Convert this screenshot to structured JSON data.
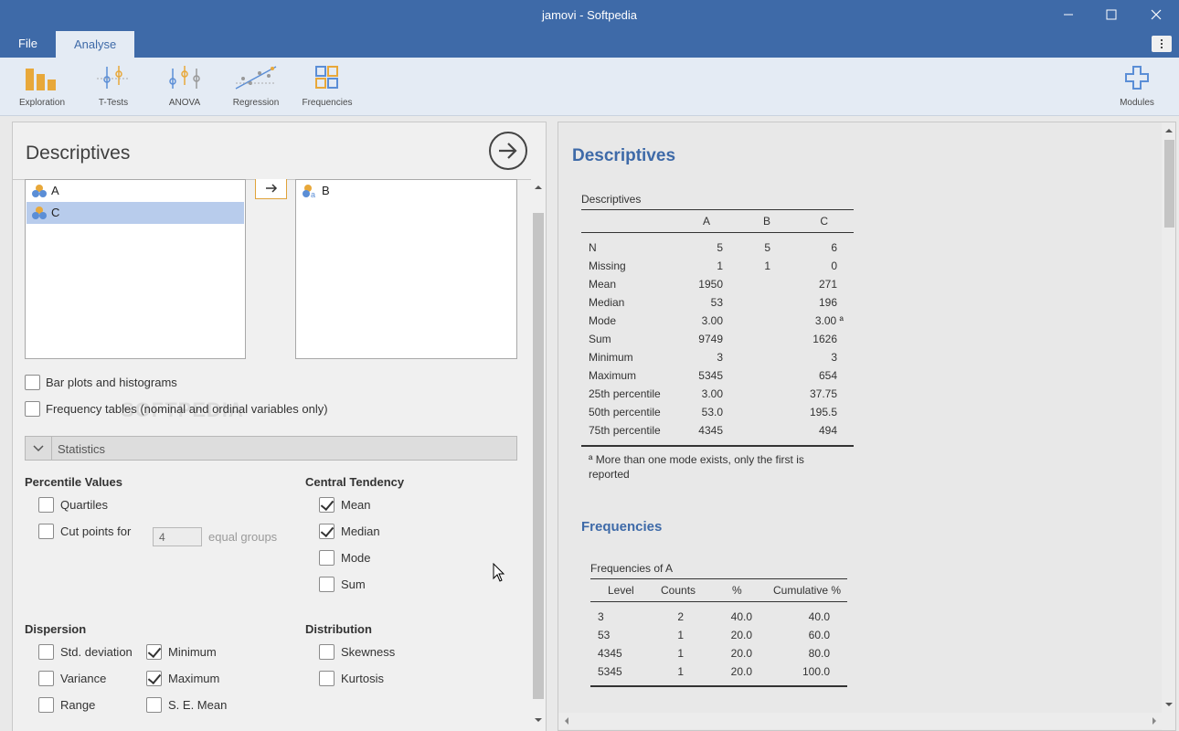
{
  "window": {
    "title": "jamovi - Softpedia",
    "minimize_icon": "minimize-icon",
    "maximize_icon": "maximize-icon",
    "close_icon": "close-icon"
  },
  "menu": {
    "tabs": [
      {
        "label": "File",
        "active": false
      },
      {
        "label": "Analyse",
        "active": true
      }
    ],
    "more_icon": "kebab-menu-icon"
  },
  "ribbon": {
    "buttons": [
      {
        "label": "Exploration",
        "icon": "exploration-icon"
      },
      {
        "label": "T-Tests",
        "icon": "t-tests-icon"
      },
      {
        "label": "ANOVA",
        "icon": "anova-icon"
      },
      {
        "label": "Regression",
        "icon": "regression-icon"
      },
      {
        "label": "Frequencies",
        "icon": "frequencies-icon"
      }
    ],
    "modules_label": "Modules",
    "modules_icon": "plus-icon"
  },
  "options": {
    "title": "Descriptives",
    "available_vars": [
      {
        "name": "A",
        "selected": false
      },
      {
        "name": "C",
        "selected": true
      }
    ],
    "target_vars": [
      {
        "name": "B"
      }
    ],
    "bar_plots_label": "Bar plots and histograms",
    "bar_plots_checked": false,
    "freq_tables_label": "Frequency tables (nominal and ordinal variables only)",
    "freq_tables_checked": false,
    "watermark": "SOFTPEDIA",
    "statistics_header": "Statistics",
    "percentile": {
      "title": "Percentile Values",
      "quartiles_label": "Quartiles",
      "quartiles_checked": false,
      "cut_points_label": "Cut points for",
      "cut_points_checked": false,
      "cut_points_value": "4",
      "equal_groups_label": "equal groups"
    },
    "central_tendency": {
      "title": "Central Tendency",
      "items": [
        {
          "label": "Mean",
          "checked": true
        },
        {
          "label": "Median",
          "checked": true
        },
        {
          "label": "Mode",
          "checked": false
        },
        {
          "label": "Sum",
          "checked": false
        }
      ]
    },
    "dispersion": {
      "title": "Dispersion",
      "col1": [
        {
          "label": "Std. deviation",
          "checked": false
        },
        {
          "label": "Variance",
          "checked": false
        },
        {
          "label": "Range",
          "checked": false
        }
      ],
      "col2": [
        {
          "label": "Minimum",
          "checked": true
        },
        {
          "label": "Maximum",
          "checked": true
        },
        {
          "label": "S. E. Mean",
          "checked": false
        }
      ]
    },
    "distribution": {
      "title": "Distribution",
      "items": [
        {
          "label": "Skewness",
          "checked": false
        },
        {
          "label": "Kurtosis",
          "checked": false
        }
      ]
    }
  },
  "results": {
    "title": "Descriptives",
    "desc_table": {
      "caption": "Descriptives",
      "columns": [
        "",
        "A",
        "B",
        "C"
      ],
      "rows": [
        [
          "N",
          "5",
          "5",
          "6"
        ],
        [
          "Missing",
          "1",
          "1",
          "0"
        ],
        [
          "Mean",
          "1950",
          "",
          "271"
        ],
        [
          "Median",
          "53",
          "",
          "196"
        ],
        [
          "Mode",
          "3.00",
          "",
          "3.00 ª"
        ],
        [
          "Sum",
          "9749",
          "",
          "1626"
        ],
        [
          "Minimum",
          "3",
          "",
          "3"
        ],
        [
          "Maximum",
          "5345",
          "",
          "654"
        ],
        [
          "25th percentile",
          "3.00",
          "",
          "37.75"
        ],
        [
          "50th percentile",
          "53.0",
          "",
          "195.5"
        ],
        [
          "75th percentile",
          "4345",
          "",
          "494"
        ]
      ],
      "footnote_line1": "ª More than one mode exists, only the first is",
      "footnote_line2": "reported"
    },
    "frequencies_title": "Frequencies",
    "freq_table": {
      "caption": "Frequencies of A",
      "columns": [
        "Level",
        "Counts",
        "%",
        "Cumulative %"
      ],
      "rows": [
        [
          "3",
          "2",
          "40.0",
          "40.0"
        ],
        [
          "53",
          "1",
          "20.0",
          "60.0"
        ],
        [
          "4345",
          "1",
          "20.0",
          "80.0"
        ],
        [
          "5345",
          "1",
          "20.0",
          "100.0"
        ]
      ]
    }
  }
}
